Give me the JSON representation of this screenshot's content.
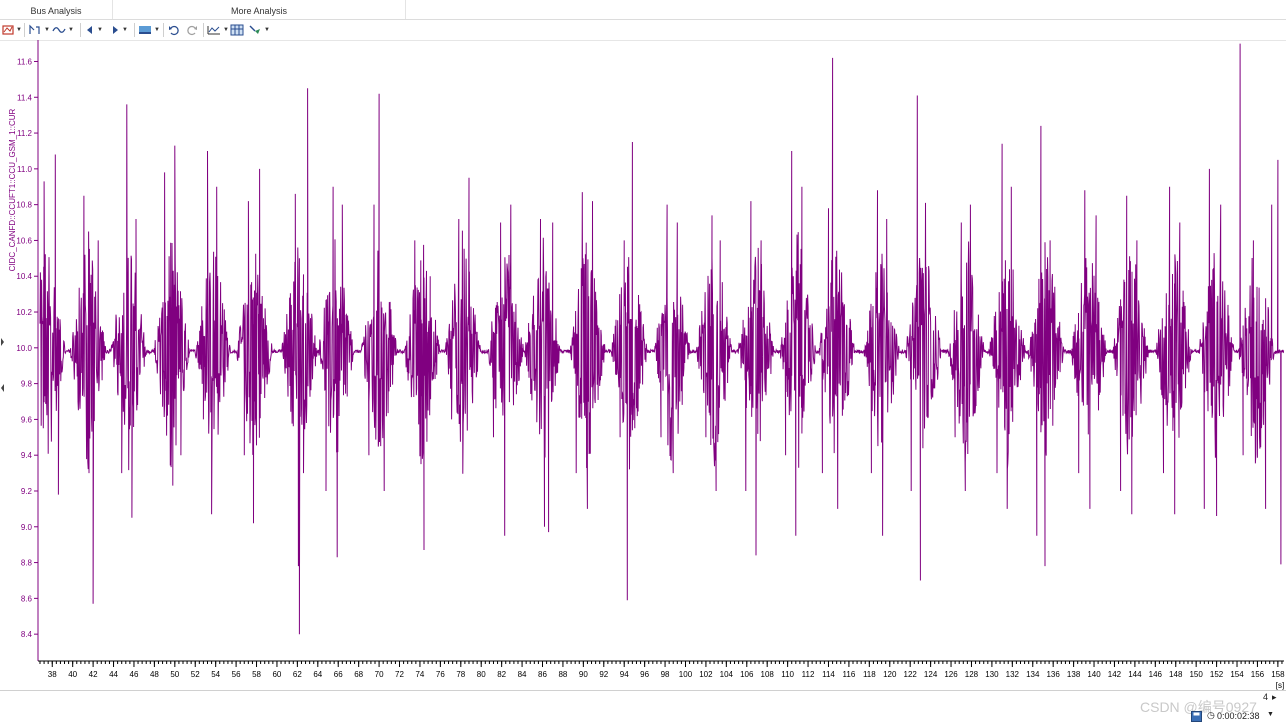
{
  "tabs": [
    {
      "label": "Bus Analysis"
    },
    {
      "label": "More Analysis"
    }
  ],
  "toolbar": {
    "icons": [
      "signal-icon",
      "cursor-icon",
      "wave-icon",
      "arrow-left-icon",
      "arrow-right-icon",
      "layout-icon",
      "undo-icon",
      "redo-icon",
      "chart-settings-icon",
      "grid-icon",
      "measure-icon"
    ]
  },
  "status": {
    "time": "0:00:02:38",
    "page": "4",
    "watermark": "CSDN @编号0927"
  },
  "colors": {
    "signal": "#800080",
    "axis": "#800080"
  },
  "chart_data": {
    "type": "line",
    "title": "",
    "ylabel": "CIDC_CANFD::CCUFT1::CCU_GSM_1::CUR",
    "xlabel": "[s]",
    "xlim": [
      36.8,
      158.6
    ],
    "ylim": [
      8.25,
      11.72
    ],
    "yticks": [
      "8.4",
      "8.6",
      "8.8",
      "9.0",
      "9.2",
      "9.4",
      "9.6",
      "9.8",
      "10.0",
      "10.2",
      "10.4",
      "10.6",
      "10.8",
      "11.0",
      "11.2",
      "11.4",
      "11.6"
    ],
    "xticks": [
      "38",
      "40",
      "42",
      "44",
      "46",
      "48",
      "50",
      "52",
      "54",
      "56",
      "58",
      "60",
      "62",
      "64",
      "66",
      "68",
      "70",
      "72",
      "74",
      "76",
      "78",
      "80",
      "82",
      "84",
      "86",
      "88",
      "90",
      "92",
      "94",
      "96",
      "98",
      "100",
      "102",
      "104",
      "106",
      "108",
      "110",
      "112",
      "114",
      "116",
      "118",
      "120",
      "122",
      "124",
      "126",
      "128",
      "130",
      "132",
      "134",
      "136",
      "138",
      "140",
      "142",
      "144",
      "146",
      "148",
      "150",
      "152",
      "154",
      "156",
      "158"
    ],
    "series": [
      {
        "baseline": 9.98,
        "burst_centers": [
          37.5,
          41.5,
          45.5,
          49.7,
          53.7,
          57.8,
          62.2,
          65.8,
          70.0,
          74.2,
          78.2,
          82.4,
          86.0,
          90.4,
          94.5,
          98.7,
          102.8,
          106.9,
          111.0,
          114.8,
          119.2,
          123.3,
          127.5,
          131.5,
          135.3,
          139.5,
          143.6,
          147.8,
          152.0,
          155.9
        ],
        "spikes": [
          [
            37.2,
            10.93
          ],
          [
            37.9,
            9.6
          ],
          [
            38.3,
            11.08
          ],
          [
            38.6,
            9.18
          ],
          [
            41.1,
            10.85
          ],
          [
            41.6,
            9.3
          ],
          [
            42.0,
            8.57
          ],
          [
            42.5,
            10.6
          ],
          [
            45.3,
            11.36
          ],
          [
            45.8,
            9.05
          ],
          [
            46.2,
            10.72
          ],
          [
            44.8,
            9.3
          ],
          [
            49.0,
            10.98
          ],
          [
            49.8,
            9.23
          ],
          [
            50.0,
            11.13
          ],
          [
            50.6,
            9.4
          ],
          [
            53.2,
            11.1
          ],
          [
            53.6,
            9.07
          ],
          [
            54.1,
            10.9
          ],
          [
            52.8,
            9.6
          ],
          [
            57.2,
            10.82
          ],
          [
            57.7,
            9.02
          ],
          [
            58.3,
            11.0
          ],
          [
            56.8,
            9.4
          ],
          [
            61.8,
            10.86
          ],
          [
            62.1,
            8.78
          ],
          [
            62.2,
            8.4
          ],
          [
            63.0,
            11.45
          ],
          [
            62.6,
            9.3
          ],
          [
            65.5,
            10.9
          ],
          [
            65.9,
            8.83
          ],
          [
            66.4,
            10.8
          ],
          [
            64.8,
            9.2
          ],
          [
            69.5,
            10.8
          ],
          [
            70.0,
            11.42
          ],
          [
            70.5,
            9.2
          ],
          [
            69.0,
            9.4
          ],
          [
            73.5,
            10.6
          ],
          [
            74.1,
            9.35
          ],
          [
            74.4,
            8.87
          ],
          [
            75.0,
            10.4
          ],
          [
            77.8,
            10.72
          ],
          [
            78.2,
            9.3
          ],
          [
            78.8,
            10.95
          ],
          [
            77.1,
            9.6
          ],
          [
            81.9,
            10.7
          ],
          [
            82.3,
            8.95
          ],
          [
            82.9,
            10.8
          ],
          [
            81.2,
            9.5
          ],
          [
            85.8,
            10.72
          ],
          [
            86.2,
            9.0
          ],
          [
            86.6,
            8.97
          ],
          [
            87.0,
            10.7
          ],
          [
            89.9,
            10.87
          ],
          [
            90.4,
            9.1
          ],
          [
            90.9,
            10.82
          ],
          [
            89.3,
            9.3
          ],
          [
            94.0,
            10.6
          ],
          [
            94.3,
            8.59
          ],
          [
            94.8,
            11.15
          ],
          [
            93.6,
            9.5
          ],
          [
            98.2,
            10.8
          ],
          [
            98.8,
            9.3
          ],
          [
            99.2,
            10.7
          ],
          [
            97.6,
            9.5
          ],
          [
            102.6,
            10.74
          ],
          [
            103.0,
            9.2
          ],
          [
            103.4,
            10.6
          ],
          [
            102.0,
            9.5
          ],
          [
            106.4,
            10.82
          ],
          [
            106.9,
            8.84
          ],
          [
            107.4,
            10.6
          ],
          [
            105.9,
            9.2
          ],
          [
            110.4,
            11.1
          ],
          [
            110.8,
            8.95
          ],
          [
            111.4,
            10.9
          ],
          [
            109.8,
            9.4
          ],
          [
            114.0,
            10.78
          ],
          [
            114.4,
            11.62
          ],
          [
            114.9,
            9.1
          ],
          [
            113.4,
            9.3
          ],
          [
            118.8,
            10.88
          ],
          [
            119.3,
            8.95
          ],
          [
            119.7,
            10.72
          ],
          [
            118.2,
            9.3
          ],
          [
            122.7,
            11.41
          ],
          [
            123.0,
            8.7
          ],
          [
            123.5,
            10.81
          ],
          [
            122.1,
            9.2
          ],
          [
            127.0,
            10.7
          ],
          [
            127.4,
            9.2
          ],
          [
            127.9,
            10.8
          ],
          [
            126.4,
            9.5
          ],
          [
            131.0,
            11.14
          ],
          [
            131.5,
            9.1
          ],
          [
            131.9,
            10.9
          ],
          [
            130.5,
            9.3
          ],
          [
            134.8,
            11.24
          ],
          [
            135.2,
            8.78
          ],
          [
            135.7,
            10.6
          ],
          [
            134.4,
            8.95
          ],
          [
            139.1,
            10.88
          ],
          [
            139.6,
            9.1
          ],
          [
            140.2,
            10.74
          ],
          [
            138.5,
            9.3
          ],
          [
            143.2,
            10.85
          ],
          [
            143.7,
            9.07
          ],
          [
            144.2,
            10.6
          ],
          [
            142.6,
            9.2
          ],
          [
            147.4,
            10.9
          ],
          [
            147.9,
            9.07
          ],
          [
            148.4,
            10.7
          ],
          [
            146.8,
            9.3
          ],
          [
            151.3,
            11.0
          ],
          [
            152.0,
            9.06
          ],
          [
            152.4,
            10.8
          ],
          [
            150.8,
            9.1
          ],
          [
            154.3,
            11.7
          ],
          [
            154.6,
            9.4
          ],
          [
            155.6,
            10.6
          ],
          [
            158.0,
            11.05
          ],
          [
            158.3,
            8.79
          ],
          [
            157.4,
            10.8
          ],
          [
            156.8,
            9.1
          ]
        ]
      }
    ]
  }
}
